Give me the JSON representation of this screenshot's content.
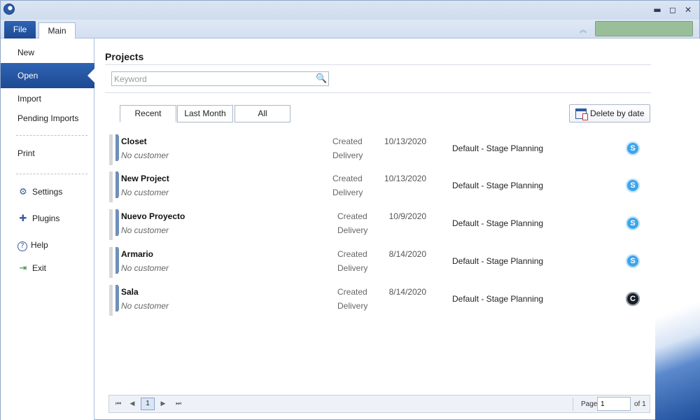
{
  "window": {
    "controls": {
      "minimize": "▬",
      "restore": "◻",
      "close": "✕"
    }
  },
  "ribbon": {
    "file_tab": "File",
    "main_tab": "Main",
    "collapse_icon": "︽"
  },
  "menu": {
    "items": [
      {
        "label": "New"
      },
      {
        "label": "Open"
      },
      {
        "label": "Import"
      },
      {
        "label": "Pending Imports"
      },
      {
        "label": "Print"
      },
      {
        "label": "Settings",
        "icon": "gear-icon",
        "glyph": "⚙"
      },
      {
        "label": "Plugins",
        "icon": "puzzle-icon",
        "glyph": "✚"
      },
      {
        "label": "Help",
        "icon": "help-icon",
        "glyph": "?"
      },
      {
        "label": "Exit",
        "icon": "exit-icon",
        "glyph": "⇥"
      }
    ]
  },
  "projects": {
    "title": "Projects",
    "search_placeholder": "Keyword",
    "search_icon_glyph": "🔍",
    "filters": [
      "Recent",
      "Last Month",
      "All"
    ],
    "delete_button": "Delete by date",
    "created_label": "Created",
    "delivery_label": "Delivery",
    "rows": [
      {
        "name": "Closet",
        "customer": "No customer",
        "created": "10/13/2020",
        "type": "Default - Stage Planning",
        "status": "S"
      },
      {
        "name": "New Project",
        "customer": "No customer",
        "created": "10/13/2020",
        "type": "Default - Stage Planning",
        "status": "S"
      },
      {
        "name": "Nuevo Proyecto",
        "customer": "No customer",
        "created": "10/9/2020",
        "type": "Default - Stage Planning",
        "status": "S"
      },
      {
        "name": "Armario",
        "customer": "No customer",
        "created": "8/14/2020",
        "type": "Default - Stage Planning",
        "status": "S"
      },
      {
        "name": "Sala",
        "customer": "No customer",
        "created": "8/14/2020",
        "type": "Default - Stage Planning",
        "status": "C"
      }
    ]
  },
  "pager": {
    "first": "⏮",
    "prev": "◀",
    "current": "1",
    "next": "▶",
    "last": "⏭",
    "page_label": "Page",
    "page_value": "1",
    "of_label": "of 1"
  },
  "colors": {
    "accent": "#1d4a93",
    "account_box": "#99bf9a",
    "status_s": "#3ea4ea",
    "status_c": "#1a1f27"
  }
}
